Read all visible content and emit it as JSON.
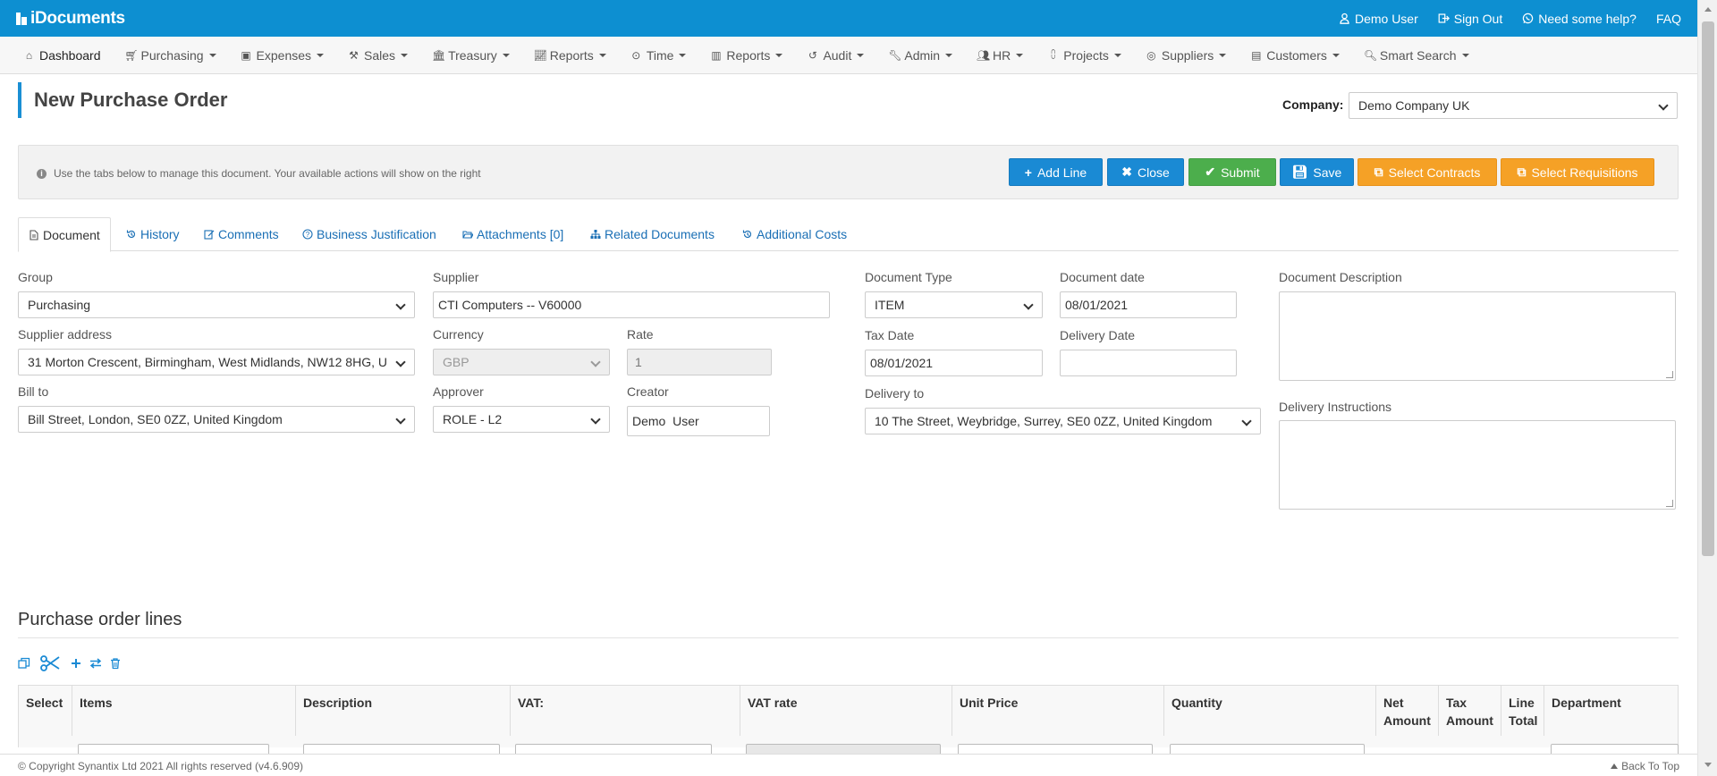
{
  "app": {
    "logo_text": "iDocuments"
  },
  "topbar": {
    "user_label": "Demo User",
    "signout_label": "Sign Out",
    "help_label": "Need some help?",
    "faq_label": "FAQ"
  },
  "nav": {
    "items": [
      {
        "label": "Dashboard",
        "icon": "home-icon"
      },
      {
        "label": "Purchasing",
        "icon": "cart-icon"
      },
      {
        "label": "Expenses",
        "icon": "money-icon"
      },
      {
        "label": "Sales",
        "icon": "gavel-icon"
      },
      {
        "label": "Treasury",
        "icon": "bank-icon"
      },
      {
        "label": "Reports",
        "icon": "line-chart-icon"
      },
      {
        "label": "Time",
        "icon": "clock-icon"
      },
      {
        "label": "Reports",
        "icon": "bar-chart-icon"
      },
      {
        "label": "Audit",
        "icon": "history-icon"
      },
      {
        "label": "Admin",
        "icon": "wrench-icon"
      },
      {
        "label": "HR",
        "icon": "users-icon"
      },
      {
        "label": "Projects",
        "icon": "sitemap-icon"
      },
      {
        "label": "Suppliers",
        "icon": "handshake-icon"
      },
      {
        "label": "Customers",
        "icon": "address-book-icon"
      },
      {
        "label": "Smart Search",
        "icon": "search-icon"
      }
    ]
  },
  "page": {
    "title": "New Purchase Order",
    "company_label": "Company:",
    "company_value": "Demo Company UK"
  },
  "infobar": {
    "text": "Use the tabs below to manage this document. Your available actions will show on the right",
    "buttons": {
      "add_line": "Add Line",
      "close": "Close",
      "submit": "Submit",
      "save": "Save",
      "select_contracts": "Select Contracts",
      "select_requisitions": "Select Requisitions"
    }
  },
  "tabs": [
    {
      "label": "Document"
    },
    {
      "label": "History"
    },
    {
      "label": "Comments"
    },
    {
      "label": "Business Justification"
    },
    {
      "label": "Attachments [0]"
    },
    {
      "label": "Related Documents"
    },
    {
      "label": "Additional Costs"
    }
  ],
  "form": {
    "group": {
      "label": "Group",
      "value": "Purchasing"
    },
    "supplier": {
      "label": "Supplier",
      "value": "CTI Computers -- V60000"
    },
    "supplier_address": {
      "label": "Supplier address",
      "value": "31 Morton Crescent, Birmingham, West Midlands, NW12 8HG, U"
    },
    "currency": {
      "label": "Currency",
      "value": "GBP"
    },
    "rate": {
      "label": "Rate",
      "value": "1"
    },
    "bill_to": {
      "label": "Bill to",
      "value": "Bill Street, London, SE0 0ZZ, United Kingdom"
    },
    "approver": {
      "label": "Approver",
      "value": "ROLE - L2"
    },
    "creator": {
      "label": "Creator",
      "value": "Demo  User"
    },
    "document_type": {
      "label": "Document Type",
      "value": "ITEM"
    },
    "document_date": {
      "label": "Document date",
      "value": "08/01/2021"
    },
    "tax_date": {
      "label": "Tax Date",
      "value": "08/01/2021"
    },
    "delivery_date": {
      "label": "Delivery Date",
      "value": ""
    },
    "delivery_to": {
      "label": "Delivery to",
      "value": "10 The Street, Weybridge, Surrey, SE0 0ZZ, United Kingdom"
    },
    "document_description": {
      "label": "Document Description"
    },
    "delivery_instructions": {
      "label": "Delivery Instructions"
    }
  },
  "lines": {
    "title": "Purchase order lines",
    "columns": [
      "Select",
      "Items",
      "Description",
      "VAT:",
      "VAT rate",
      "Unit Price",
      "Quantity",
      "Net Amount",
      "Tax Amount",
      "Line Total",
      "Department"
    ]
  },
  "footer": {
    "copyright": "© Copyright Synantix Ltd 2021 All rights reserved (v4.6.909)",
    "back_to_top": "Back To Top"
  },
  "colors": {
    "brand_blue": "#0d8fd1",
    "button_blue": "#1a8ad4",
    "button_green": "#4cae4c",
    "button_orange": "#f5a126"
  }
}
